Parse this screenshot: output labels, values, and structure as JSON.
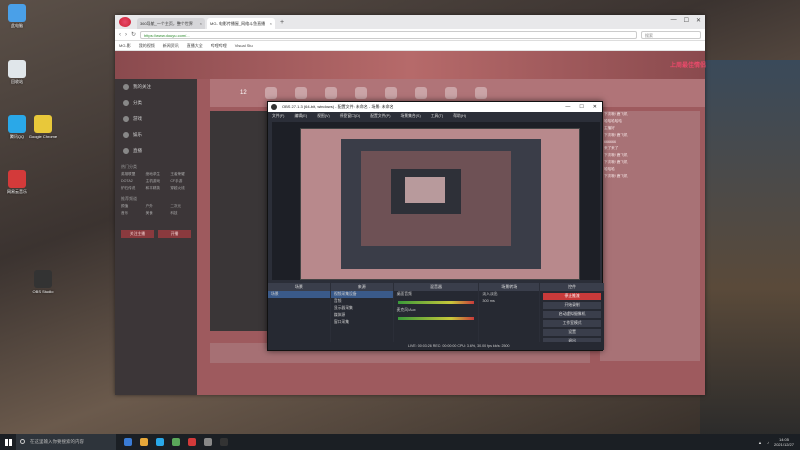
{
  "desktop": {
    "icons": [
      {
        "label": "此电脑",
        "color": "#4aa0e8"
      },
      {
        "label": "回收站",
        "color": "#e0e6ea"
      },
      {
        "label": "腾讯QQ",
        "color": "#2aa8e8"
      },
      {
        "label": "网易云音乐",
        "color": "#d33a3a"
      },
      {
        "label": "Google Chrome",
        "color": "#e8c83a"
      },
      {
        "label": "OBS Studio",
        "color": "#333333"
      }
    ]
  },
  "browser": {
    "tabs": [
      {
        "label": "360导航_一个主页，整个世界",
        "active": false
      },
      {
        "label": "MG- 电影传播屋_网络斗鱼直播",
        "active": true
      }
    ],
    "new_tab": "+",
    "window_buttons": {
      "min": "—",
      "max": "☐",
      "close": "✕"
    },
    "address": "https://www.douyu.com/...",
    "search_placeholder": "搜索",
    "bookmarks": [
      "MG-影",
      "我的视频",
      "新闻资讯",
      "直播大全",
      "哔哩哔哩",
      "Visual Stu"
    ]
  },
  "douyu": {
    "sidebar": {
      "items": [
        "我的关注",
        "分类",
        "游戏",
        "娱乐",
        "直播"
      ],
      "section1": "热门分类",
      "grid1": [
        "英雄联盟",
        "绝地求生",
        "王者荣耀",
        "DOTA2",
        "主机游戏",
        "CF手游",
        "炉石传说",
        "和平精英",
        "穿越火线"
      ],
      "section2": "推荐频道",
      "grid2": [
        "颜值",
        "户外",
        "二次元",
        "音乐",
        "美食",
        "科技"
      ],
      "follow_button": "关注主播",
      "open_button": "开播"
    },
    "chat_lines": [
      "下次哦! 鹿飞机",
      "哈哈哈哈哈",
      "主播好",
      "下次哦! 鹿飞机",
      "666666",
      "来了来了",
      "下次哦! 鹿飞机",
      "下次哦! 鹿飞机",
      "哈哈哈",
      "下次哦! 鹿飞机"
    ],
    "room_number": "12",
    "deco_text": "上周最佳情侣"
  },
  "obs": {
    "title": "OBS 27.1.3 (64-bit, windows) - 配置文件: 未命名 - 场景: 未命名",
    "window_buttons": {
      "min": "—",
      "max": "☐",
      "close": "✕"
    },
    "menu": [
      "文件(F)",
      "编辑(E)",
      "视图(V)",
      "停靠窗口(D)",
      "配置文件(P)",
      "场景集合(S)",
      "工具(T)",
      "帮助(H)"
    ],
    "panels": {
      "scenes": {
        "header": "场景",
        "items": [
          "场景"
        ]
      },
      "sources": {
        "header": "来源",
        "items": [
          "视频采集设备",
          "音频",
          "显示器采集",
          "媒体源",
          "窗口采集"
        ]
      },
      "mixer": {
        "header": "混音器",
        "items": [
          "桌面音频",
          "麦克风/Aux"
        ]
      },
      "transitions": {
        "header": "场景转场",
        "value": "淡入淡出",
        "duration": "300 ms"
      },
      "controls": {
        "header": "控件",
        "buttons": [
          "停止推流",
          "开始录制",
          "启动虚拟摄像机",
          "工作室模式",
          "设置",
          "退出"
        ]
      }
    },
    "status": "LIVE: 00:03:26   REC: 00:00:00   CPU: 3.6%, 30.00 fps   kb/s: 2500"
  },
  "taskbar": {
    "search_placeholder": "在这里输入你要搜索的内容",
    "apps": [
      "#3a7bd5",
      "#e8a83a",
      "#2aa8e8",
      "#5aa85a",
      "#d33a3a",
      "#888888",
      "#333333"
    ],
    "time": "14:05",
    "date": "2021/12/27"
  }
}
